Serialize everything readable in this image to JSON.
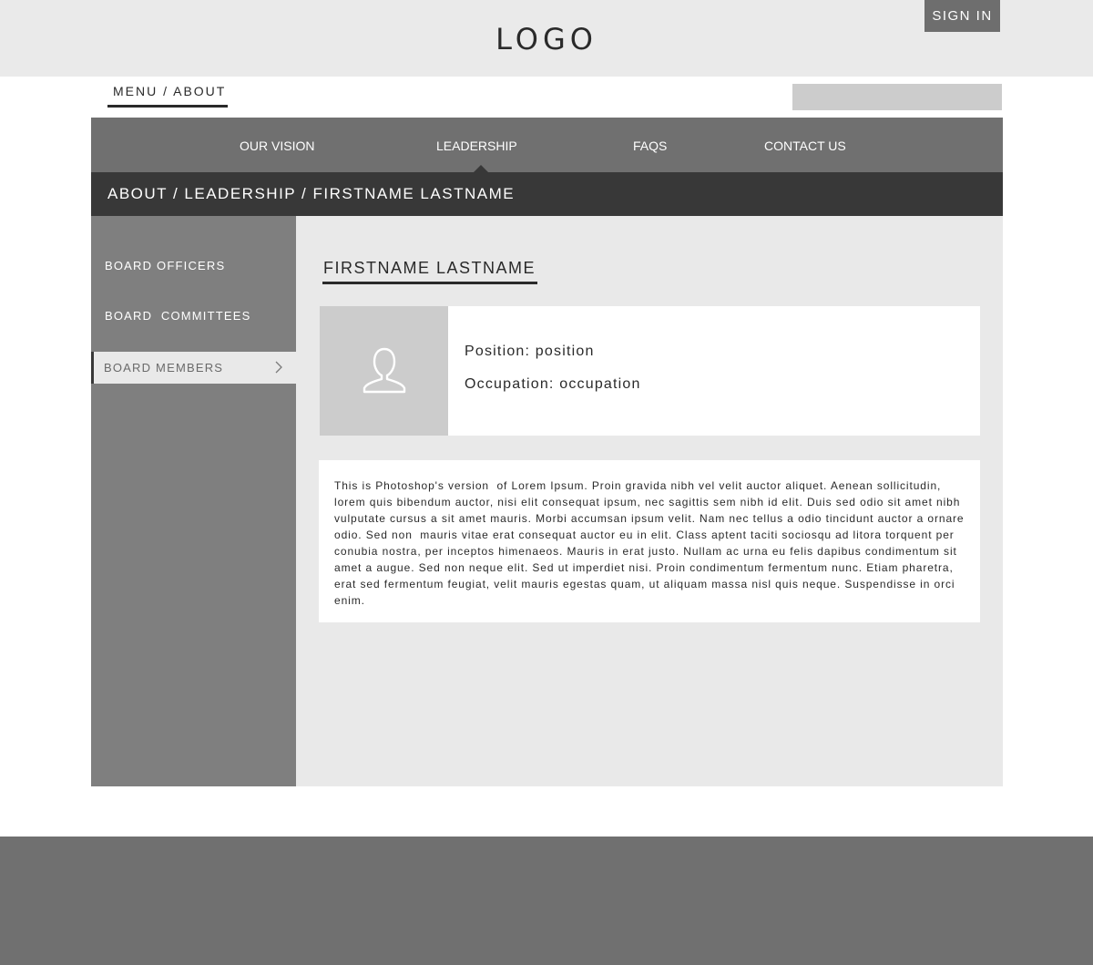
{
  "header": {
    "logo": "LOGO",
    "sign_in_label": "SIGN IN"
  },
  "top_breadcrumb": "MENU / ABOUT",
  "search": {
    "placeholder": ""
  },
  "nav": {
    "items": [
      {
        "label": "OUR VISION"
      },
      {
        "label": "LEADERSHIP"
      },
      {
        "label": "FAQS"
      },
      {
        "label": "CONTACT US"
      }
    ],
    "active": "LEADERSHIP"
  },
  "breadcrumb_bar": "ABOUT / LEADERSHIP / FIRSTNAME LASTNAME",
  "sidebar": {
    "items": [
      {
        "label": "BOARD OFFICERS"
      },
      {
        "label": "BOARD  COMMITTEES"
      },
      {
        "label": "BOARD MEMBERS",
        "active": true,
        "icon": "chevron-right-icon"
      }
    ]
  },
  "profile": {
    "name": "FIRSTNAME LASTNAME",
    "avatar_icon": "user-icon",
    "position": "Position: position",
    "occupation": "Occupation: occupation",
    "bio": "This is Photoshop's version  of Lorem Ipsum. Proin gravida nibh vel velit auctor aliquet. Aenean sollicitudin, lorem quis bibendum auctor, nisi elit consequat ipsum, nec sagittis sem nibh id elit. Duis sed odio sit amet nibh vulputate cursus a sit amet mauris. Morbi accumsan ipsum velit. Nam nec tellus a odio tincidunt auctor a ornare odio. Sed non  mauris vitae erat consequat auctor eu in elit. Class aptent taciti sociosqu ad litora torquent per conubia nostra, per inceptos himenaeos. Mauris in erat justo. Nullam ac urna eu felis dapibus condimentum sit amet a augue. Sed non neque elit. Sed ut imperdiet nisi. Proin condimentum fermentum nunc. Etiam pharetra, erat sed fermentum feugiat, velit mauris egestas quam, ut aliquam massa nisl quis neque. Suspendisse in orci enim."
  },
  "colors": {
    "header_bg": "#eaeaea",
    "nav_bg": "#707070",
    "breadcrumb_bg": "#383838",
    "sidebar_bg": "#7f7f7f",
    "content_bg": "#e9e9e9",
    "footer_bg": "#707070",
    "sign_in_bg": "#6e6e6e"
  }
}
